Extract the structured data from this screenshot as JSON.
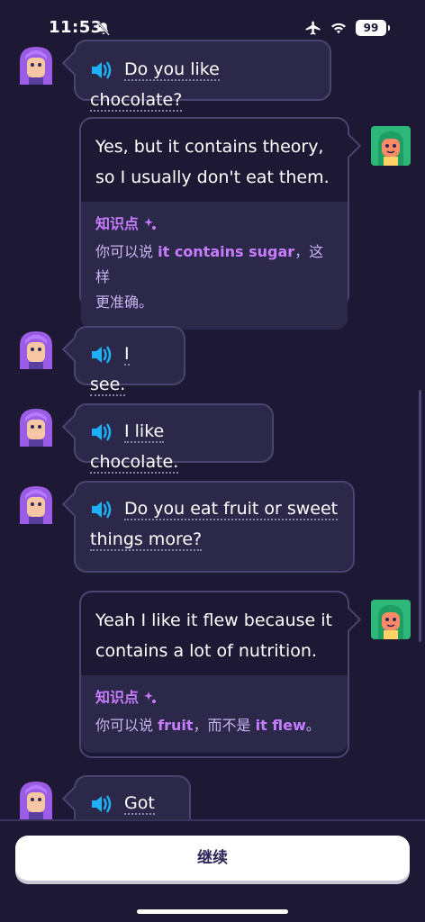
{
  "status_bar": {
    "time": "11:53",
    "battery": "99",
    "icons": [
      "bell-off-icon",
      "airplane-icon",
      "wifi-icon",
      "battery-icon"
    ]
  },
  "messages": [
    {
      "speaker": "tutor",
      "text": "Do you like chocolate?"
    },
    {
      "speaker": "user",
      "text_line1": "Yes, but it contains theory,",
      "text_line2": "so I usually don't eat them.",
      "tip_title": "知识点",
      "tip_prefix": "你可以说",
      "tip_bold": "it contains sugar",
      "tip_suffix_line1": "，这样",
      "tip_suffix_line2": "更准确。"
    },
    {
      "speaker": "tutor",
      "text": "I see."
    },
    {
      "speaker": "tutor",
      "text": "I like chocolate."
    },
    {
      "speaker": "tutor",
      "text_line1": "Do you eat fruit or sweet",
      "text_line2": "things more?"
    },
    {
      "speaker": "user",
      "text_line1": "Yeah I like it flew because it",
      "text_line2": "contains a lot of nutrition.",
      "tip_title": "知识点",
      "tip_prefix": "你可以说",
      "tip_bold": "fruit",
      "tip_middle": "，而不是",
      "tip_bold2": "it flew",
      "tip_end": "。"
    },
    {
      "speaker": "tutor",
      "text": "Got it."
    }
  ],
  "footer": {
    "continue_label": "继续"
  },
  "colors": {
    "background": "#1d1934",
    "bubble": "#2c2849",
    "accent_purple": "#c77dff",
    "speaker_blue": "#1cb0f6"
  }
}
